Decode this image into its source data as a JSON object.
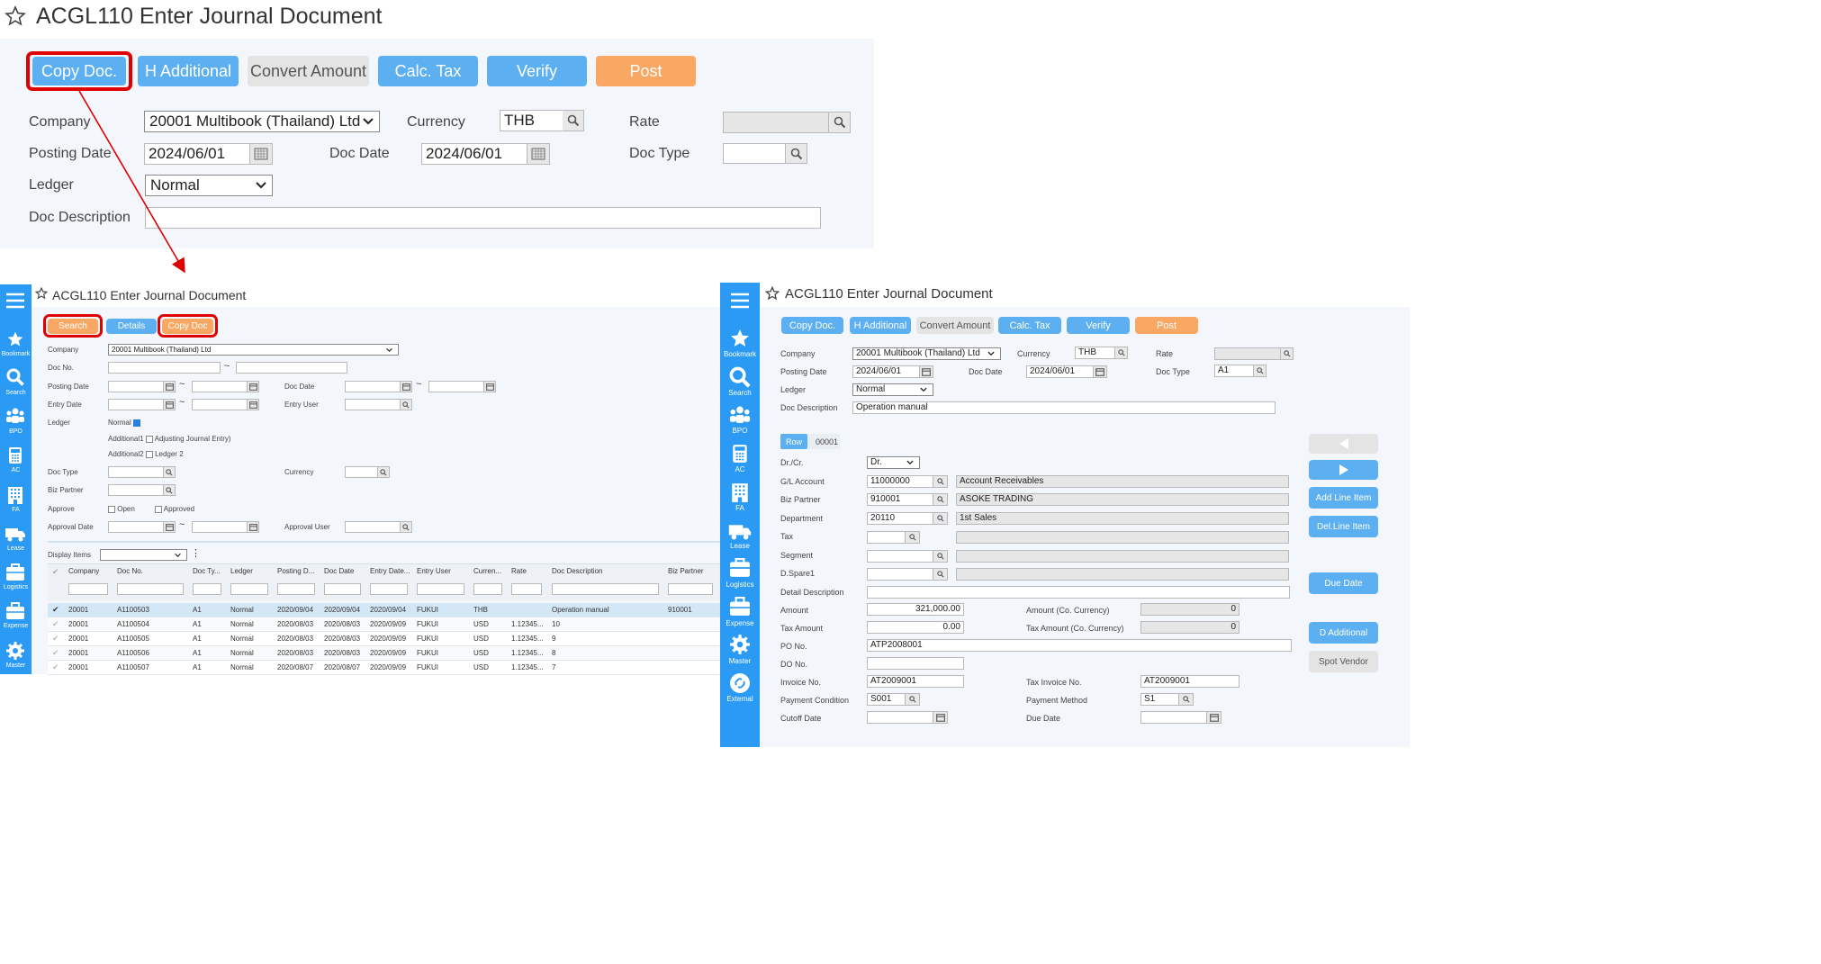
{
  "top": {
    "title": "ACGL110 Enter Journal Document",
    "buttons": [
      "Copy Doc.",
      "H Additional",
      "Convert Amount",
      "Calc. Tax",
      "Verify",
      "Post"
    ],
    "labels": {
      "company": "Company",
      "currency": "Currency",
      "rate": "Rate",
      "posting_date": "Posting Date",
      "doc_date": "Doc Date",
      "doc_type": "Doc Type",
      "ledger": "Ledger",
      "doc_description": "Doc Description"
    },
    "values": {
      "company": "20001 Multibook (Thailand) Ltd",
      "currency": "THB",
      "posting_date": "2024/06/01",
      "doc_date": "2024/06/01",
      "ledger": "Normal"
    }
  },
  "left": {
    "title": "ACGL110 Enter Journal Document",
    "buttons": [
      "Search",
      "Details",
      "Copy Doc"
    ],
    "nav": [
      "Bookmark",
      "Search",
      "BPO",
      "AC",
      "FA",
      "Lease",
      "Logistics",
      "Expense",
      "Master"
    ],
    "labels": {
      "company": "Company",
      "doc_no": "Doc No.",
      "posting_date": "Posting Date",
      "doc_date": "Doc Date",
      "entry_date": "Entry Date",
      "entry_user": "Entry User",
      "ledger": "Ledger",
      "doc_type": "Doc Type",
      "currency": "Currency",
      "biz_partner": "Biz Partner",
      "approve": "Approve",
      "approval_date": "Approval Date",
      "approval_user": "Approval User",
      "display_items": "Display Items",
      "tilde": "~"
    },
    "values": {
      "company": "20001 Multibook (Thailand) Ltd"
    },
    "ledger_options": [
      "Normal",
      "Additional1",
      "Adjusting Journal Entry)",
      "Additional2",
      "Ledger 2"
    ],
    "approve_options": [
      "Open",
      "Approved"
    ],
    "columns": [
      "Company",
      "Doc No.",
      "Doc Ty...",
      "Ledger",
      "Posting D...",
      "Doc Date",
      "Entry Date...",
      "Entry User",
      "Curren...",
      "Rate",
      "Doc Description",
      "Biz Partner"
    ],
    "rows": [
      [
        "20001",
        "A1100503",
        "A1",
        "Normal",
        "2020/09/04",
        "2020/09/04",
        "2020/09/04",
        "FUKUI",
        "THB",
        "",
        "Operation manual",
        "910001"
      ],
      [
        "20001",
        "A1100504",
        "A1",
        "Normal",
        "2020/08/03",
        "2020/08/03",
        "2020/09/09",
        "FUKUI",
        "USD",
        "1.12345...",
        "10",
        ""
      ],
      [
        "20001",
        "A1100505",
        "A1",
        "Normal",
        "2020/08/03",
        "2020/08/03",
        "2020/09/09",
        "FUKUI",
        "USD",
        "1.12345...",
        "9",
        ""
      ],
      [
        "20001",
        "A1100506",
        "A1",
        "Normal",
        "2020/08/03",
        "2020/08/03",
        "2020/09/09",
        "FUKUI",
        "USD",
        "1.12345...",
        "8",
        ""
      ],
      [
        "20001",
        "A1100507",
        "A1",
        "Normal",
        "2020/08/07",
        "2020/08/07",
        "2020/09/09",
        "FUKUI",
        "USD",
        "1.12345...",
        "7",
        ""
      ]
    ]
  },
  "right": {
    "title": "ACGL110 Enter Journal Document",
    "buttons": [
      "Copy Doc.",
      "H Additional",
      "Convert Amount",
      "Calc. Tax",
      "Verify",
      "Post"
    ],
    "nav": [
      "Bookmark",
      "Search",
      "BPO",
      "AC",
      "FA",
      "Lease",
      "Logistics",
      "Expense",
      "Master",
      "External"
    ],
    "labels": {
      "company": "Company",
      "currency": "Currency",
      "rate": "Rate",
      "posting_date": "Posting Date",
      "doc_date": "Doc Date",
      "doc_type": "Doc Type",
      "ledger": "Ledger",
      "doc_description": "Doc Description",
      "row": "Row",
      "row_no": "00001",
      "drcr": "Dr./Cr.",
      "gl": "G/L Account",
      "biz": "Biz Partner",
      "dept": "Department",
      "tax": "Tax",
      "segment": "Segment",
      "dspare": "D.Spare1",
      "detail": "Detail Description",
      "amount": "Amount",
      "amount_co": "Amount (Co. Currency)",
      "tax_amount": "Tax Amount",
      "tax_amount_co": "Tax Amount (Co. Currency)",
      "po": "PO No.",
      "do": "DO No.",
      "invoice": "Invoice No.",
      "tax_invoice": "Tax Invoice No.",
      "pay_cond": "Payment Condition",
      "pay_method": "Payment Method",
      "cutoff": "Cutoff Date",
      "due": "Due Date"
    },
    "values": {
      "company": "20001 Multibook (Thailand) Ltd",
      "currency": "THB",
      "posting_date": "2024/06/01",
      "doc_date": "2024/06/01",
      "doc_type": "A1",
      "ledger": "Normal",
      "doc_description": "Operation manual",
      "drcr": "Dr.",
      "gl": "11000000",
      "gl_name": "Account Receivables",
      "biz": "910001",
      "biz_name": "ASOKE TRADING",
      "dept": "20110",
      "dept_name": "1st Sales",
      "amount": "321,000.00",
      "amount_co": "0",
      "tax_amount": "0.00",
      "tax_amount_co": "0",
      "po": "ATP2008001",
      "invoice": "AT2009001",
      "tax_invoice": "AT2009001",
      "pay_cond": "S001",
      "pay_method": "S1"
    },
    "side_buttons": [
      "Add Line Item",
      "Del.Line Item",
      "Due Date",
      "D Additional",
      "Spot Vendor"
    ]
  },
  "colors": {
    "blue": "#5cb0f2",
    "orange": "#f9a864",
    "rail": "#2a9af5",
    "highlight": "#e00000"
  }
}
